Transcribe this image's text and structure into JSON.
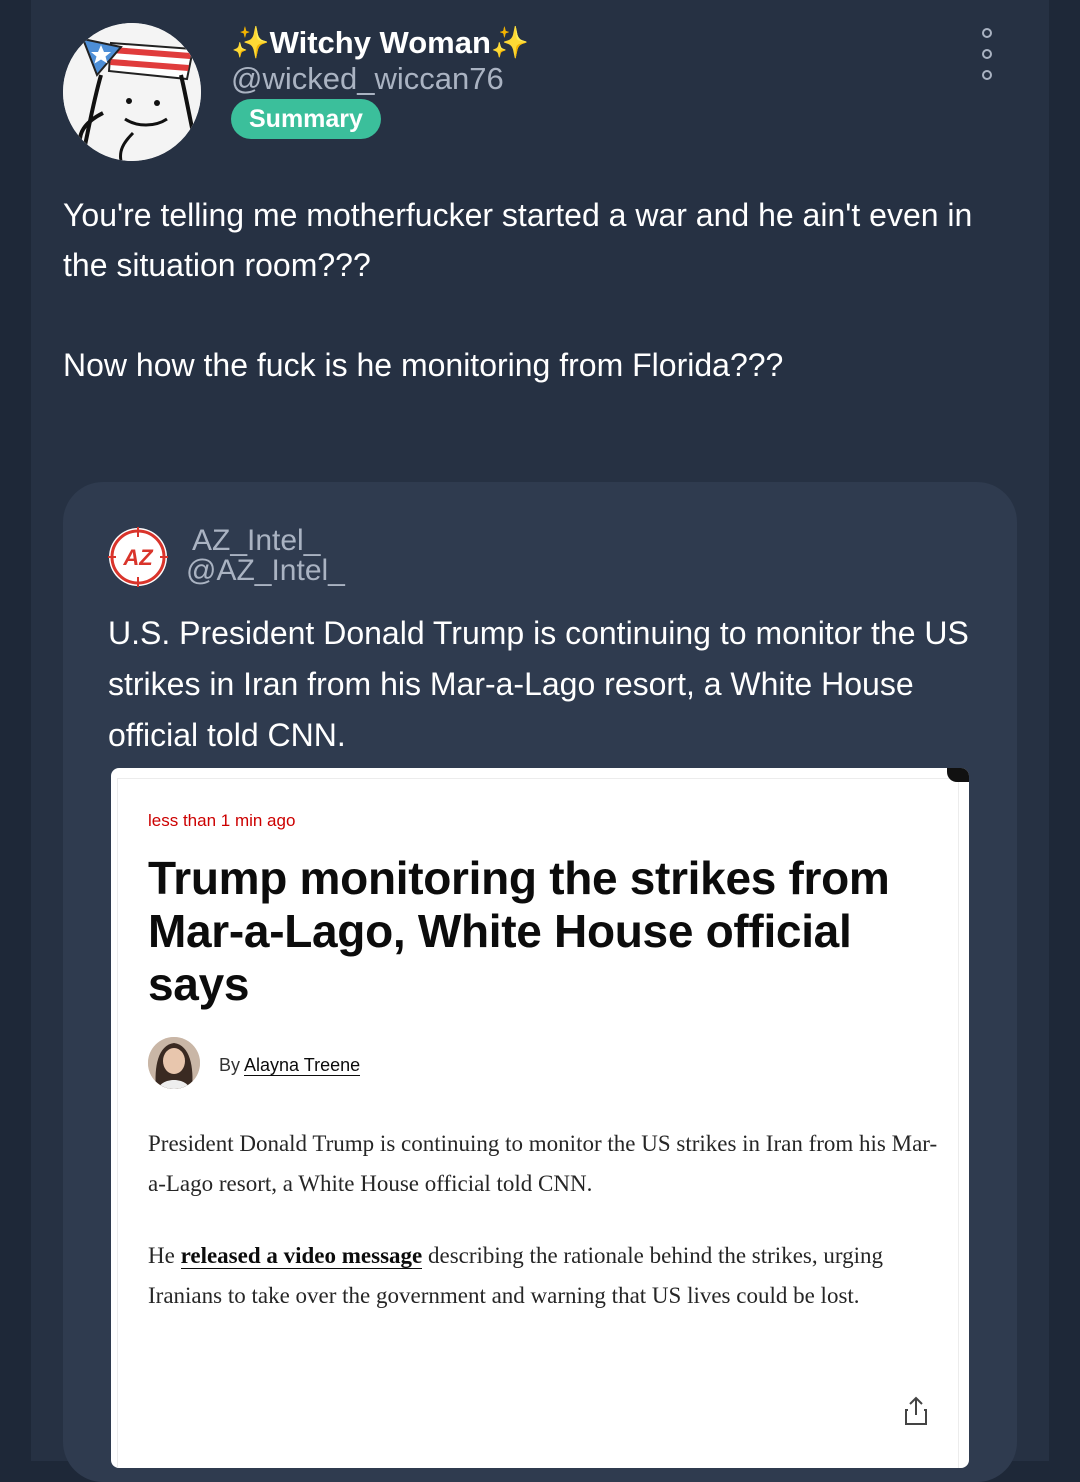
{
  "post": {
    "author_name": "✨Witchy Woman✨",
    "author_handle": "@wicked_wiccan76",
    "badge": "Summary",
    "menu_icon": "more-vertical-icon",
    "text_paragraphs": [
      "You're telling me motherfucker started a war and he ain't even in the situation room???",
      "Now how the fuck is he monitoring from Florida???"
    ]
  },
  "quote": {
    "avatar_text": "AZ",
    "name": "AZ_Intel_",
    "handle": "@AZ_Intel_",
    "text": "U.S. President Donald Trump is continuing to monitor the US strikes in Iran from his Mar-a-Lago resort, a White House official told CNN."
  },
  "article": {
    "timestamp": "less than 1 min ago",
    "headline": "Trump monitoring the strikes from Mar-a-Lago, White House official says",
    "byline_prefix": "By",
    "byline_name": "Alayna Treene",
    "paragraph1": "President Donald Trump is continuing to monitor the US strikes in Iran from his Mar-a-Lago resort, a White House official told CNN.",
    "paragraph2_start": "He",
    "paragraph2_link": "released a video message",
    "paragraph2_rest": "describing the rationale behind the strikes, urging Iranians to take over the government and warning that US lives could be lost.",
    "share_icon": "share-icon"
  },
  "colors": {
    "background": "#1e2838",
    "card": "#263143",
    "quote_card": "#2f3b4f",
    "badge": "#3bbf9b",
    "muted_text": "#aab3c2",
    "article_timestamp": "#cc0000",
    "az_logo": "#d9342b"
  }
}
